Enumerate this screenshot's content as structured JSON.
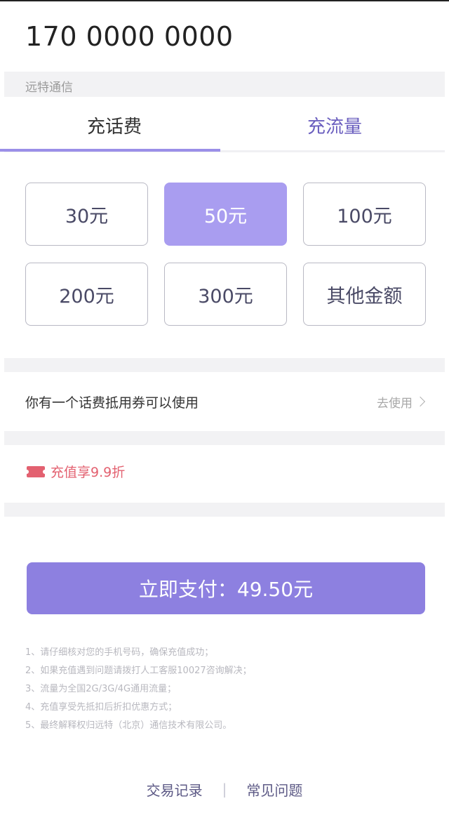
{
  "phone_number": "170 0000 0000",
  "carrier": "远特通信",
  "tabs": [
    {
      "label": "充话费",
      "active": true
    },
    {
      "label": "充流量",
      "active": false
    }
  ],
  "amounts": [
    {
      "label": "30元",
      "selected": false
    },
    {
      "label": "50元",
      "selected": true
    },
    {
      "label": "100元",
      "selected": false
    },
    {
      "label": "200元",
      "selected": false
    },
    {
      "label": "300元",
      "selected": false
    },
    {
      "label": "其他金额",
      "selected": false
    }
  ],
  "coupon": {
    "text": "你有一个话费抵用券可以使用",
    "action": "去使用"
  },
  "promo": {
    "text": "充值享9.9折",
    "icon": "ticket-icon"
  },
  "pay_button": "立即支付：49.50元",
  "notes": [
    "1、请仔细核对您的手机号码，确保充值成功；",
    "2、如果充值遇到问题请拨打人工客服10027咨询解决；",
    "3、流量为全国2G/3G/4G通用流量；",
    "4、充值享受先抵扣后折扣优惠方式；",
    "5、最终解释权归远特（北京）通信技术有限公司。"
  ],
  "footer": {
    "records": "交易记录",
    "separator": "|",
    "faq": "常见问题"
  },
  "colors": {
    "accent": "#8d80e0",
    "selected_amount": "#a99df0",
    "promo": "#e36170"
  }
}
